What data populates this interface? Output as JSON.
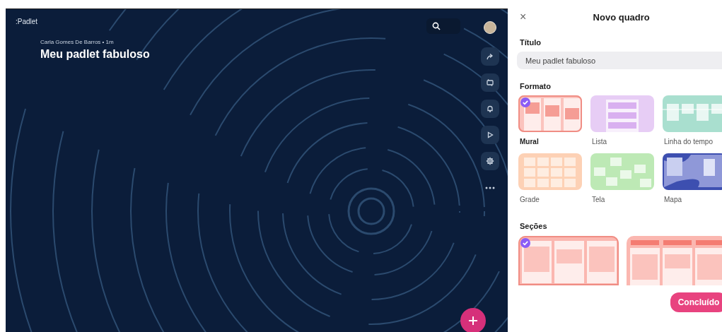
{
  "board": {
    "logo": ":Padlet",
    "author_line": "Carla Gomes De Barros • 1m",
    "title": "Meu padlet fabuloso"
  },
  "panel": {
    "close": "×",
    "heading": "Novo quadro",
    "title_label": "Título",
    "title_value": "Meu padlet fabuloso",
    "format_label": "Formato",
    "formats": [
      {
        "kind": "mural",
        "label": "Mural",
        "selected": true
      },
      {
        "kind": "list",
        "label": "Lista",
        "selected": false
      },
      {
        "kind": "timeline",
        "label": "Linha do tempo",
        "selected": false
      },
      {
        "kind": "grid",
        "label": "Grade",
        "selected": false
      },
      {
        "kind": "canvas",
        "label": "Tela",
        "selected": false
      },
      {
        "kind": "map",
        "label": "Mapa",
        "selected": false
      }
    ],
    "sections_label": "Seções",
    "sections": [
      {
        "kind": "plain",
        "selected": true
      },
      {
        "kind": "headers",
        "selected": false
      }
    ],
    "done_button": "Concluído"
  }
}
